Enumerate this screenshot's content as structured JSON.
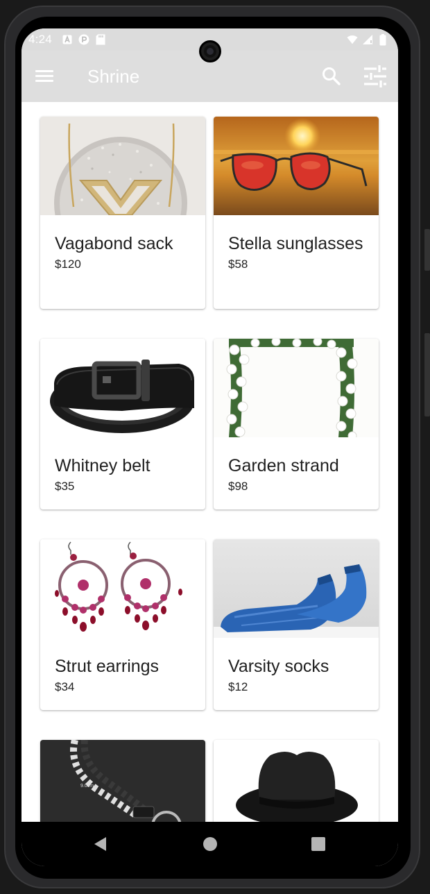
{
  "status_bar": {
    "time": "4:24",
    "left_icons": [
      "a-notification-icon",
      "p-notification-icon",
      "sd-card-icon"
    ],
    "right_icons": [
      "wifi-icon",
      "signal-icon",
      "battery-icon"
    ]
  },
  "app_bar": {
    "title": "Shrine",
    "icons": [
      "menu-icon",
      "search-icon",
      "tune-icon"
    ]
  },
  "products": [
    {
      "name": "Vagabond sack",
      "price": "$120",
      "image": "crystal-clutch-bag"
    },
    {
      "name": "Stella sunglasses",
      "price": "$58",
      "image": "aviator-sunglasses-on-sand"
    },
    {
      "name": "Whitney belt",
      "price": "$35",
      "image": "black-leather-belt"
    },
    {
      "name": "Garden strand",
      "price": "$98",
      "image": "white-rose-arch"
    },
    {
      "name": "Strut earrings",
      "price": "$34",
      "image": "beaded-chandelier-earrings"
    },
    {
      "name": "Varsity socks",
      "price": "$12",
      "image": "blue-ankle-socks"
    },
    {
      "name": "",
      "price": "",
      "image": "braided-keychain",
      "photo_text": "9.0cm"
    },
    {
      "name": "",
      "price": "",
      "image": "black-fedora-hat"
    }
  ],
  "nav_bar": {
    "buttons": [
      "back-icon",
      "home-icon",
      "recents-icon"
    ]
  },
  "colors": {
    "app_bar": "#dedede",
    "status_bar": "#dcdcdc",
    "nav_bar": "#000000",
    "text_primary": "#1f1f1f"
  }
}
